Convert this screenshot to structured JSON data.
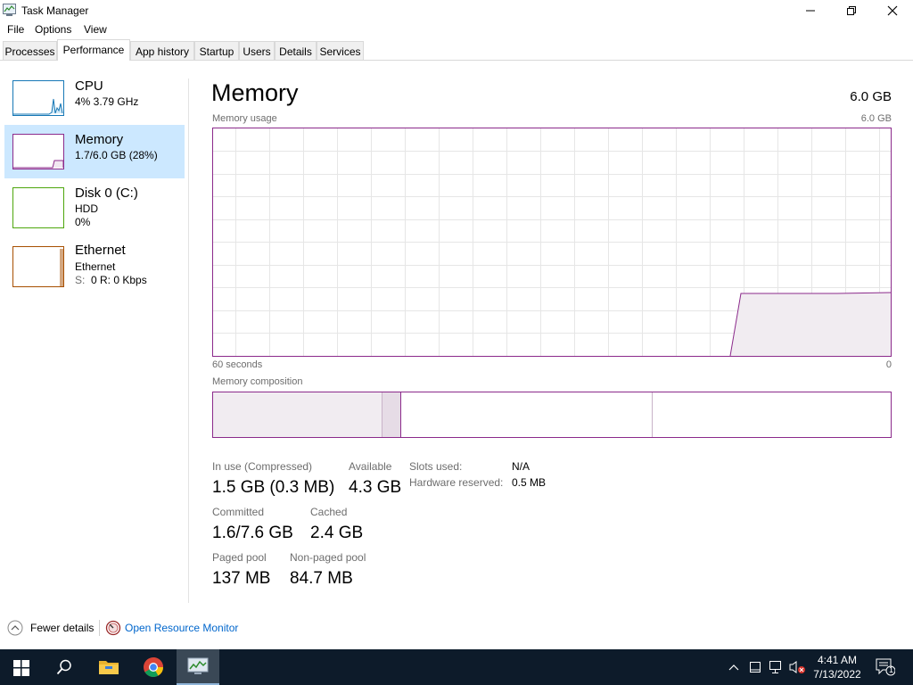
{
  "window": {
    "title": "Task Manager",
    "menu": [
      "File",
      "Options",
      "View"
    ],
    "tabs": [
      "Processes",
      "Performance",
      "App history",
      "Startup",
      "Users",
      "Details",
      "Services"
    ],
    "active_tab": "Performance"
  },
  "sidebar": {
    "items": [
      {
        "name": "CPU",
        "line1": "4% 3.79 GHz",
        "line2": "",
        "color": "#1778b6"
      },
      {
        "name": "Memory",
        "line1": "1.7/6.0 GB (28%)",
        "line2": "",
        "color": "#8b2a8b",
        "selected": true
      },
      {
        "name": "Disk 0 (C:)",
        "line1": "HDD",
        "line2": "0%",
        "color": "#4da60c"
      },
      {
        "name": "Ethernet",
        "line1": "Ethernet",
        "line2_prefix": "S:",
        "line2": "0 R: 0 Kbps",
        "color": "#a74f01"
      }
    ]
  },
  "main": {
    "title": "Memory",
    "total": "6.0 GB",
    "usage_label": "Memory usage",
    "usage_max": "6.0 GB",
    "time_left": "60 seconds",
    "time_right": "0",
    "composition_label": "Memory composition",
    "stats": {
      "in_use_label": "In use (Compressed)",
      "in_use_value": "1.5 GB (0.3 MB)",
      "available_label": "Available",
      "available_value": "4.3 GB",
      "committed_label": "Committed",
      "committed_value": "1.6/7.6 GB",
      "cached_label": "Cached",
      "cached_value": "2.4 GB",
      "paged_label": "Paged pool",
      "paged_value": "137 MB",
      "nonpaged_label": "Non-paged pool",
      "nonpaged_value": "84.7 MB",
      "slots_label": "Slots used:",
      "slots_value": "N/A",
      "hw_reserved_label": "Hardware reserved:",
      "hw_reserved_value": "0.5 MB"
    }
  },
  "footer": {
    "fewer_details": "Fewer details",
    "open_resource_monitor": "Open Resource Monitor"
  },
  "taskbar": {
    "time": "4:41 AM",
    "date": "7/13/2022",
    "notification_count": "1"
  },
  "colors": {
    "accent_memory": "#8b2a8b",
    "selected_bg": "#cce8ff",
    "link": "#0066cc",
    "taskbar_bg": "#0d1b2a"
  }
}
